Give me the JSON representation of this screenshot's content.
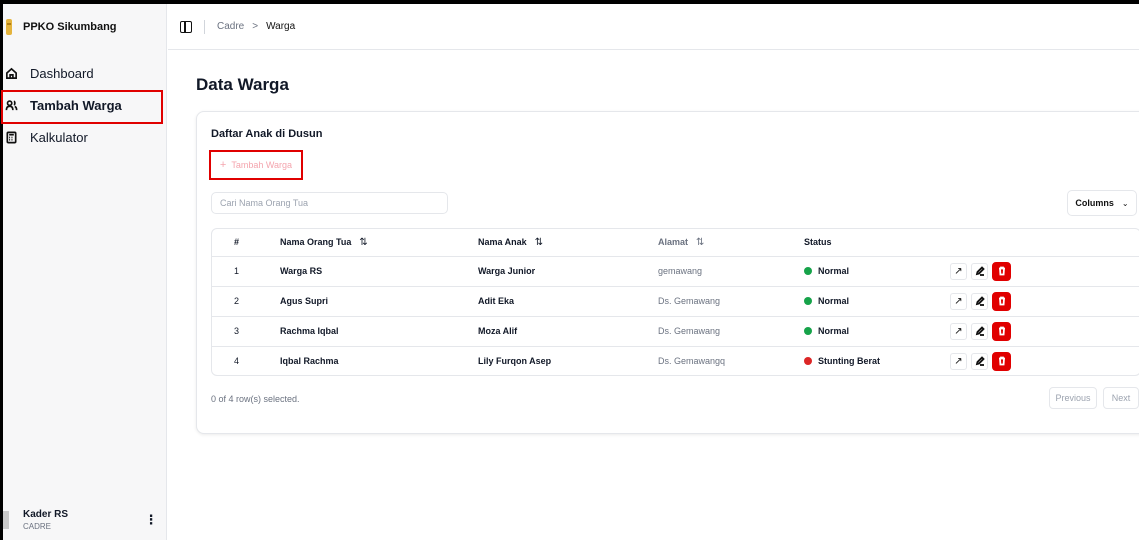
{
  "app": {
    "name": "PPKO Sikumbang"
  },
  "sidebar": {
    "items": [
      {
        "label": "Dashboard",
        "icon": "home-icon",
        "active": false
      },
      {
        "label": "Tambah Warga",
        "icon": "users-icon",
        "active": true
      },
      {
        "label": "Kalkulator",
        "icon": "calculator-icon",
        "active": false
      }
    ],
    "user": {
      "name": "Kader RS",
      "role": "CADRE"
    }
  },
  "breadcrumb": {
    "parent": "Cadre",
    "separator": ">",
    "current": "Warga"
  },
  "page": {
    "title": "Data Warga"
  },
  "card": {
    "title": "Daftar Anak di Dusun",
    "add_button": "Tambah Warga",
    "search_placeholder": "Cari Nama Orang Tua",
    "columns_button": "Columns"
  },
  "table": {
    "headers": {
      "num": "#",
      "orang_tua": "Nama Orang Tua",
      "anak": "Nama Anak",
      "alamat": "Alamat",
      "status": "Status"
    },
    "rows": [
      {
        "num": "1",
        "orang_tua": "Warga RS",
        "anak": "Warga Junior",
        "alamat": "gemawang",
        "status": "Normal",
        "status_color": "#16a34a"
      },
      {
        "num": "2",
        "orang_tua": "Agus Supri",
        "anak": "Adit Eka",
        "alamat": "Ds. Gemawang",
        "status": "Normal",
        "status_color": "#16a34a"
      },
      {
        "num": "3",
        "orang_tua": "Rachma Iqbal",
        "anak": "Moza Alif",
        "alamat": "Ds. Gemawang",
        "status": "Normal",
        "status_color": "#16a34a"
      },
      {
        "num": "4",
        "orang_tua": "Iqbal Rachma",
        "anak": "Lily Furqon Asep",
        "alamat": "Ds. Gemawangq",
        "status": "Stunting Berat",
        "status_color": "#dc2626"
      }
    ]
  },
  "footer": {
    "selected": "0 of 4 row(s) selected.",
    "previous": "Previous",
    "next": "Next"
  },
  "colors": {
    "accent": "#e00000",
    "normal": "#16a34a",
    "danger": "#dc2626"
  }
}
